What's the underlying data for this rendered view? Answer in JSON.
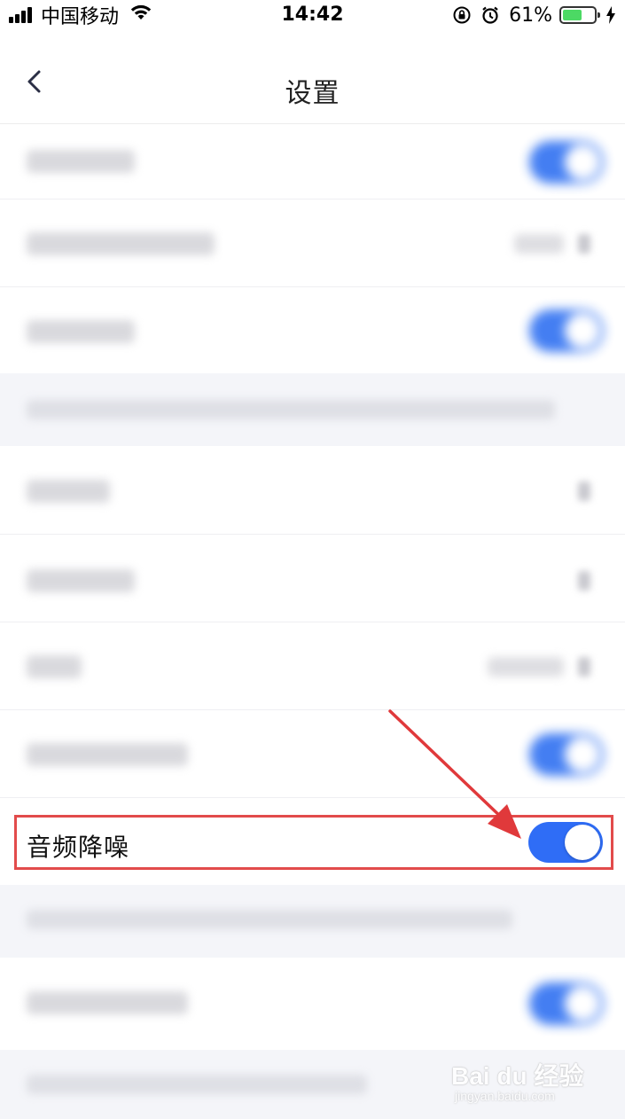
{
  "status_bar": {
    "carrier": "中国移动",
    "time": "14:42",
    "battery_percent": "61%",
    "battery_level": 0.61
  },
  "nav": {
    "title": "设置"
  },
  "highlighted_row": {
    "label": "音频降噪",
    "toggle_on": true
  },
  "colors": {
    "accent": "#2f6df6",
    "highlight_border": "#e24b4b",
    "section_bg": "#f4f5f9"
  },
  "watermark": {
    "brand": "Bai du 经验",
    "site": "jingyan.baidu.com"
  }
}
